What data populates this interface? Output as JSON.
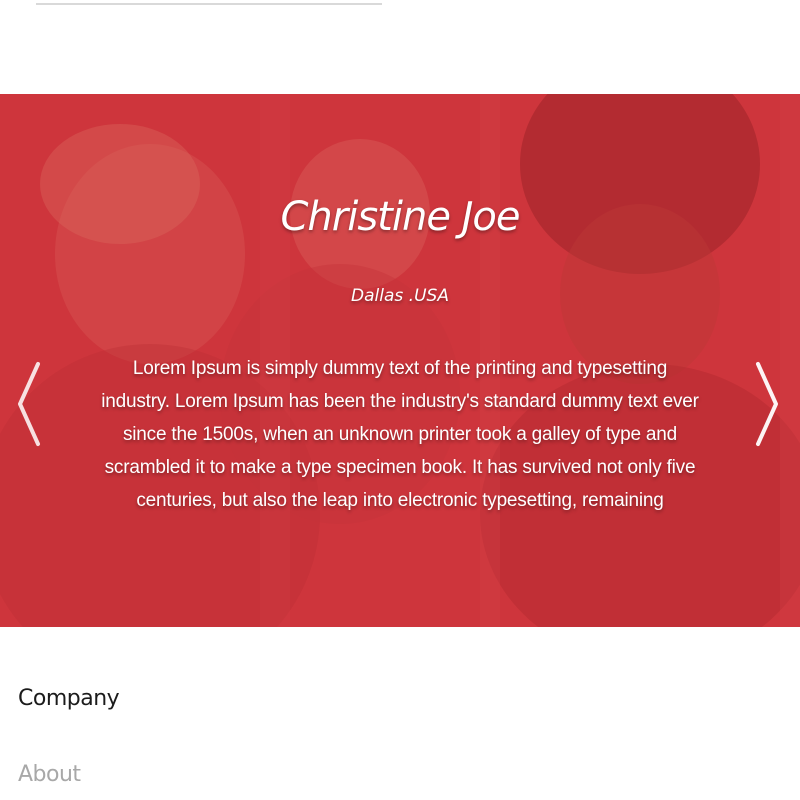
{
  "testimonial": {
    "name": "Christine Joe",
    "location": "Dallas .USA",
    "quote": "Lorem Ipsum is simply dummy text of the printing and typesetting industry. Lorem Ipsum has been the industry's standard dummy text ever since the 1500s, when an unknown printer took a galley of type and scrambled it to make a type specimen book. It has survived not only five centuries, but also the leap into electronic typesetting, remaining"
  },
  "slider": {
    "overlay_color": "#cc343a",
    "prev_icon": "chevron-left-icon",
    "next_icon": "chevron-right-icon"
  },
  "footer": {
    "heading": "Company",
    "links": [
      "About"
    ]
  }
}
